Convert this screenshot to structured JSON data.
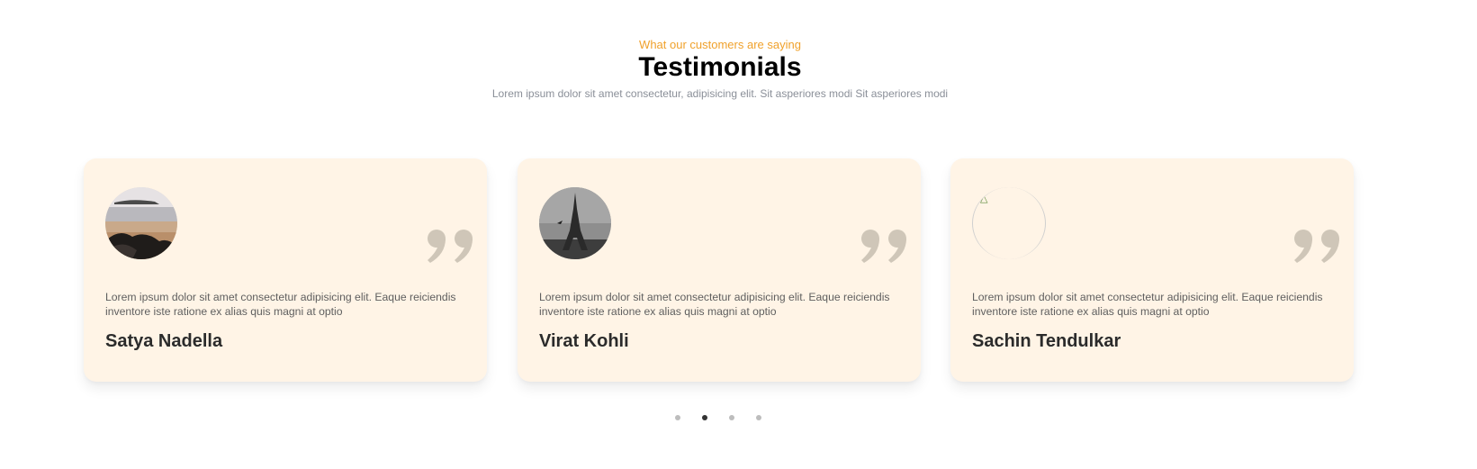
{
  "header": {
    "kicker": "What our customers are saying",
    "title": "Testimonials",
    "subtitle": "Lorem ipsum dolor sit amet consectetur, adipisicing elit. Sit asperiores modi Sit asperiores modi"
  },
  "testimonials": [
    {
      "avatar": "beach-rocks-photo",
      "text": "Lorem ipsum dolor sit amet consectetur adipisicing elit. Eaque reiciendis inventore iste ratione ex alias quis magni at optio",
      "name": "Satya Nadella"
    },
    {
      "avatar": "eiffel-tower-photo",
      "text": "Lorem ipsum dolor sit amet consectetur adipisicing elit. Eaque reiciendis inventore iste ratione ex alias quis magni at optio",
      "name": "Virat Kohli"
    },
    {
      "avatar": "broken-image",
      "text": "Lorem ipsum dolor sit amet consectetur adipisicing elit. Eaque reiciendis inventore iste ratione ex alias quis magni at optio",
      "name": "Sachin Tendulkar"
    }
  ],
  "quote_icon": "closing-quote-icon",
  "pagination": {
    "count": 4,
    "active_index": 1
  },
  "colors": {
    "accent": "#f0a12b",
    "card_bg": "#fff4e6",
    "quote": "#cfc6b8",
    "dot_inactive": "#bdbdbd",
    "dot_active": "#333333"
  }
}
